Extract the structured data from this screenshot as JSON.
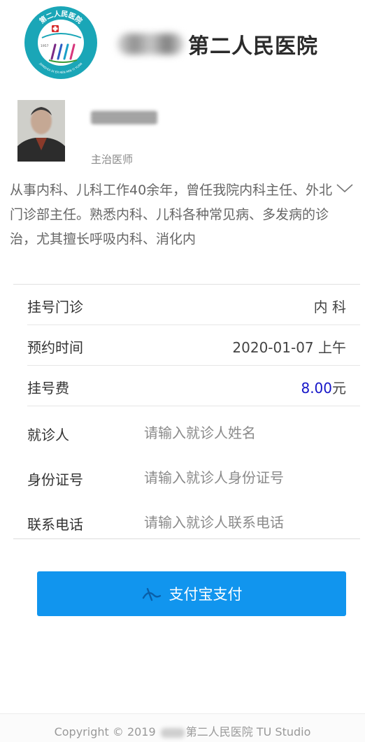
{
  "header": {
    "logo_top_text": "第二人民医院",
    "logo_bottom_text": "JIANSHUI DI ER REN MIN YI YUAN",
    "logo_year": "1957",
    "hospital_name": "第二人民医院"
  },
  "doctor": {
    "title": "主治医师",
    "bio": "从事内科、儿科工作40余年，曾任我院内科主任、外北门诊部主任。熟悉内科、儿科各种常见病、多发病的诊治，尤其擅长呼吸内科、消化内"
  },
  "appointment": {
    "dept_label": "挂号门诊",
    "dept_value": "内 科",
    "time_label": "预约时间",
    "time_value": "2020-01-07 上午",
    "fee_label": "挂号费",
    "fee_amount": "8.00",
    "fee_unit": "元"
  },
  "form": {
    "patient_label": "就诊人",
    "patient_placeholder": "请输入就诊人姓名",
    "id_label": "身份证号",
    "id_placeholder": "请输入就诊人身份证号",
    "phone_label": "联系电话",
    "phone_placeholder": "请输入就诊人联系电话"
  },
  "payment": {
    "button_label": "支付宝支付",
    "icon": "alipay-icon"
  },
  "footer": {
    "prefix": "Copyright © 2019",
    "suffix": "第二人民医院 TU Studio"
  },
  "colors": {
    "accent": "#1195ee",
    "fee_amount": "#1515c8",
    "logo_ring": "#1aa6b7"
  }
}
